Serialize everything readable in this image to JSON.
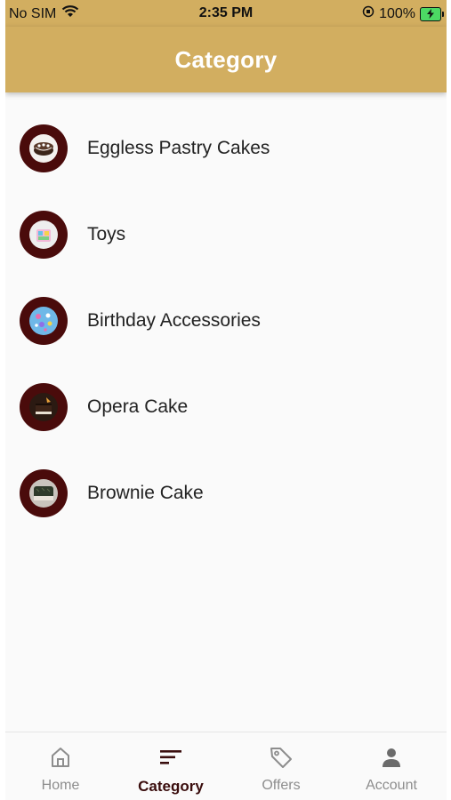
{
  "status_bar": {
    "carrier": "No SIM",
    "time": "2:35 PM",
    "battery": "100%"
  },
  "app_bar": {
    "title": "Category"
  },
  "categories": [
    {
      "label": "Eggless Pastry Cakes",
      "icon": "cake-thumbnail"
    },
    {
      "label": "Toys",
      "icon": "toys-thumbnail"
    },
    {
      "label": "Birthday Accessories",
      "icon": "accessories-thumbnail"
    },
    {
      "label": "Opera Cake",
      "icon": "opera-cake-thumbnail"
    },
    {
      "label": "Brownie Cake",
      "icon": "brownie-cake-thumbnail"
    }
  ],
  "bottom_nav": {
    "items": [
      {
        "label": "Home",
        "icon": "home-icon"
      },
      {
        "label": "Category",
        "icon": "category-icon",
        "active": true
      },
      {
        "label": "Offers",
        "icon": "tag-icon"
      },
      {
        "label": "Account",
        "icon": "person-icon"
      }
    ]
  },
  "colors": {
    "brand": "#d2ae60",
    "thumb_ring": "#4a0b0b",
    "nav_active": "#3a0d0d",
    "nav_inactive": "#8d8d8d"
  }
}
